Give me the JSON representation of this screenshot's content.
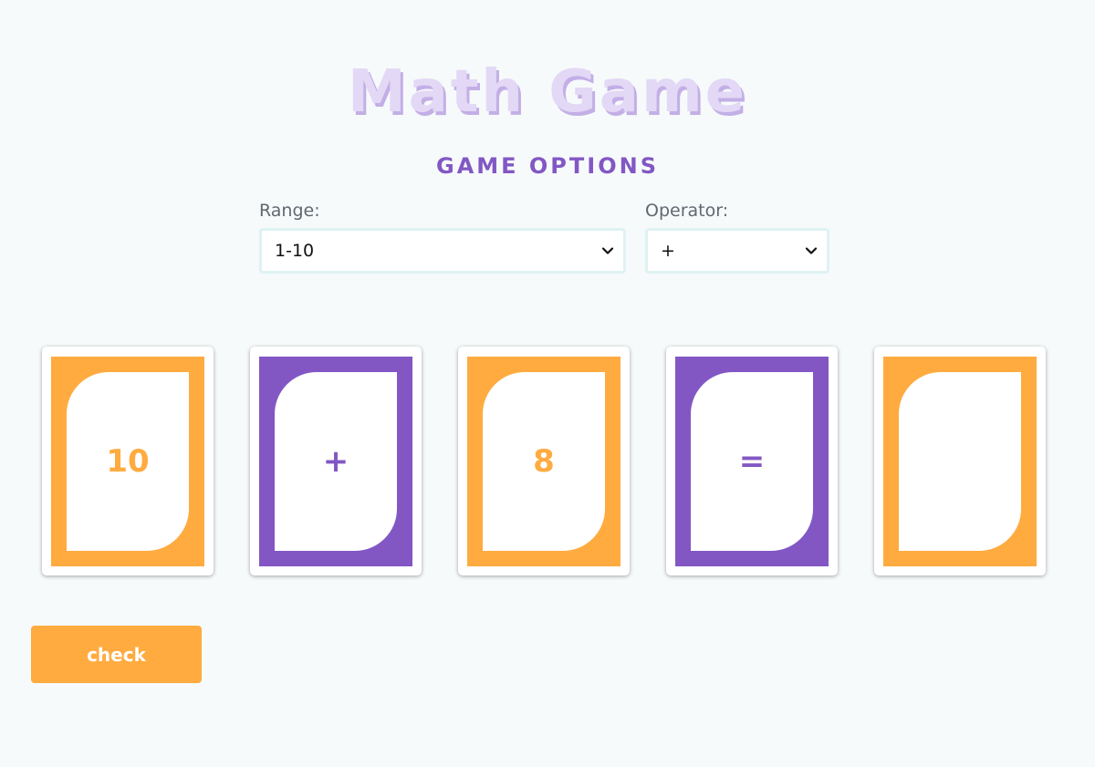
{
  "title": "Math Game",
  "options": {
    "heading": "GAME OPTIONS",
    "range_label": "Range:",
    "range_value": "1-10",
    "operator_label": "Operator:",
    "operator_value": "+"
  },
  "cards": [
    {
      "symbol": "10",
      "frame_color": "#ffab40",
      "text_color": "#ffab40"
    },
    {
      "symbol": "+",
      "frame_color": "#8257c4",
      "text_color": "#8257c4"
    },
    {
      "symbol": "8",
      "frame_color": "#ffab40",
      "text_color": "#ffab40"
    },
    {
      "symbol": "=",
      "frame_color": "#8257c4",
      "text_color": "#8257c4"
    },
    {
      "symbol": "",
      "frame_color": "#ffab40",
      "text_color": "#ffab40"
    }
  ],
  "check_label": "check",
  "icons": {
    "select_arrow": "chevron-down-icon"
  },
  "colors": {
    "orange": "#ffab40",
    "purple": "#8257c4",
    "title": "#e3d8f5",
    "background": "#f6fafb"
  }
}
